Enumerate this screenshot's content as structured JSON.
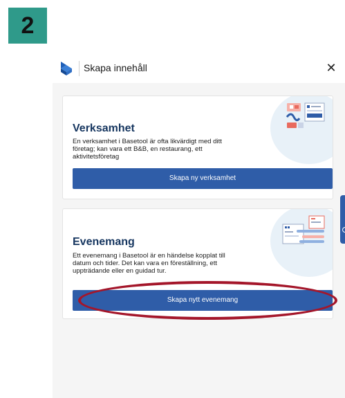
{
  "step": {
    "number": "2"
  },
  "modal": {
    "title": "Skapa innehåll",
    "close_symbol": "✕"
  },
  "cards": [
    {
      "title": "Verksamhet",
      "description": "En verksamhet i Basetool är ofta likvärdigt med ditt företag; kan vara ett B&B, en restaurang, ett aktivitetsföretag",
      "button_label": "Skapa ny verksamhet"
    },
    {
      "title": "Evenemang",
      "description": "Ett evenemang i Basetool är en händelse kopplat till datum och tider. Det kan vara en föreställning, ett uppträdande eller en guidad tur.",
      "button_label": "Skapa nytt evenemang"
    }
  ],
  "colors": {
    "step_badge": "#2f9a8a",
    "button": "#2f5da8",
    "card_title": "#15355f",
    "highlight": "#a4162a",
    "modal_bg": "#f5f5f5"
  },
  "icons": {
    "logo": "basetool-logo-icon",
    "close": "close-icon",
    "card1_illustration": "business-illustration-icon",
    "card2_illustration": "calendar-illustration-icon"
  }
}
